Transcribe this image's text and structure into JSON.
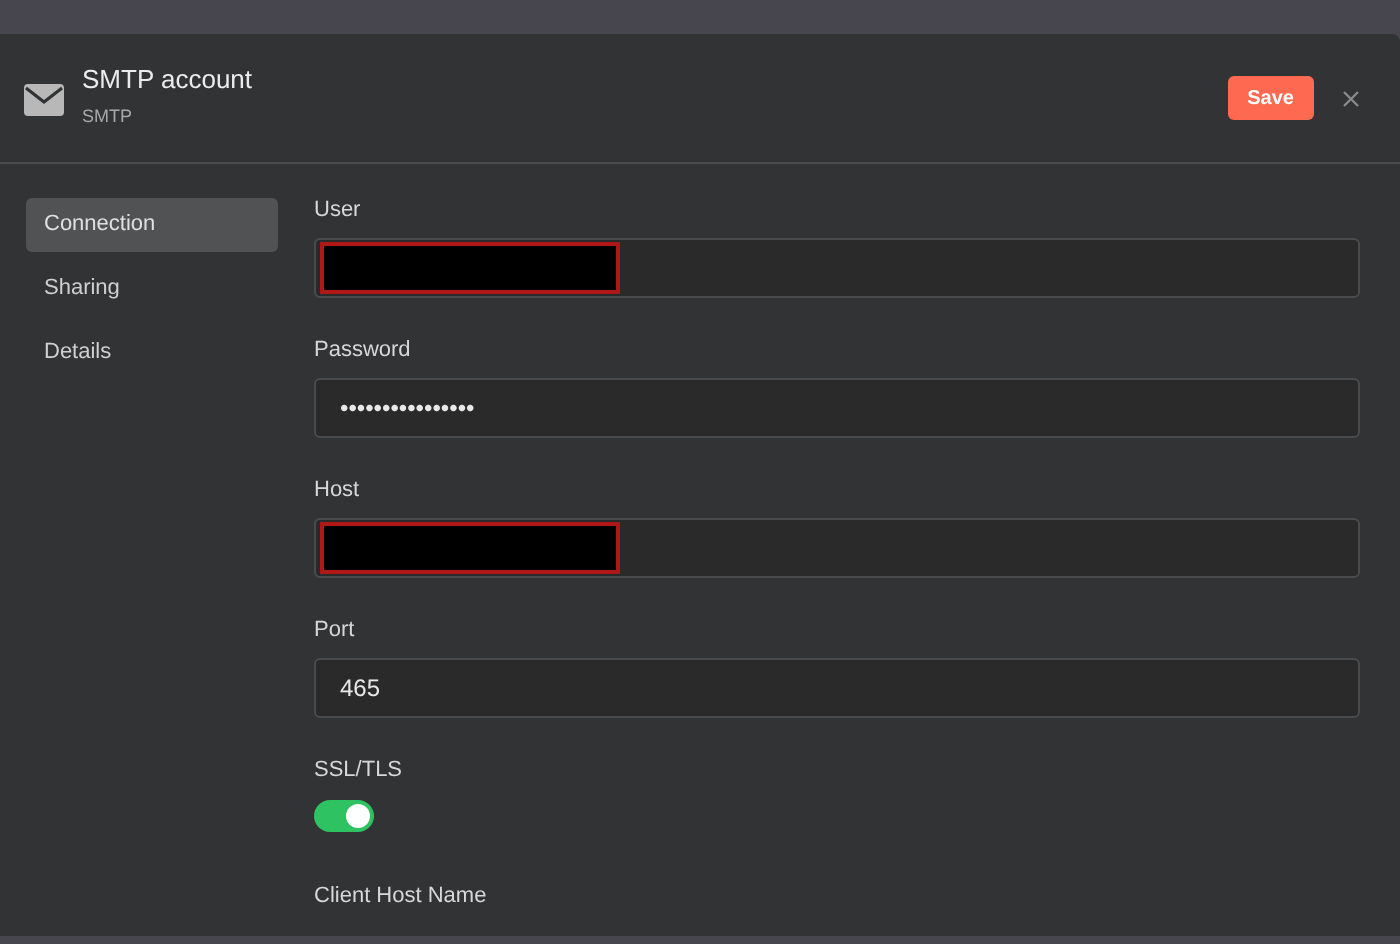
{
  "dialog": {
    "title": "SMTP account",
    "subtitle": "SMTP",
    "save_button": "Save"
  },
  "sidebar": {
    "items": [
      {
        "label": "Connection",
        "selected": true
      },
      {
        "label": "Sharing",
        "selected": false
      },
      {
        "label": "Details",
        "selected": false
      }
    ]
  },
  "fields": [
    {
      "kind": "text",
      "label": "User",
      "redacted": true
    },
    {
      "kind": "text",
      "label": "Password",
      "value": "••••••••••••••••",
      "redacted": false
    },
    {
      "kind": "text",
      "label": "Host",
      "redacted": true
    },
    {
      "kind": "text",
      "label": "Port",
      "value": "465",
      "redacted": false
    },
    {
      "kind": "toggle",
      "label": "SSL/TLS",
      "on": true
    },
    {
      "kind": "heading",
      "label": "Client Host Name"
    }
  ]
}
